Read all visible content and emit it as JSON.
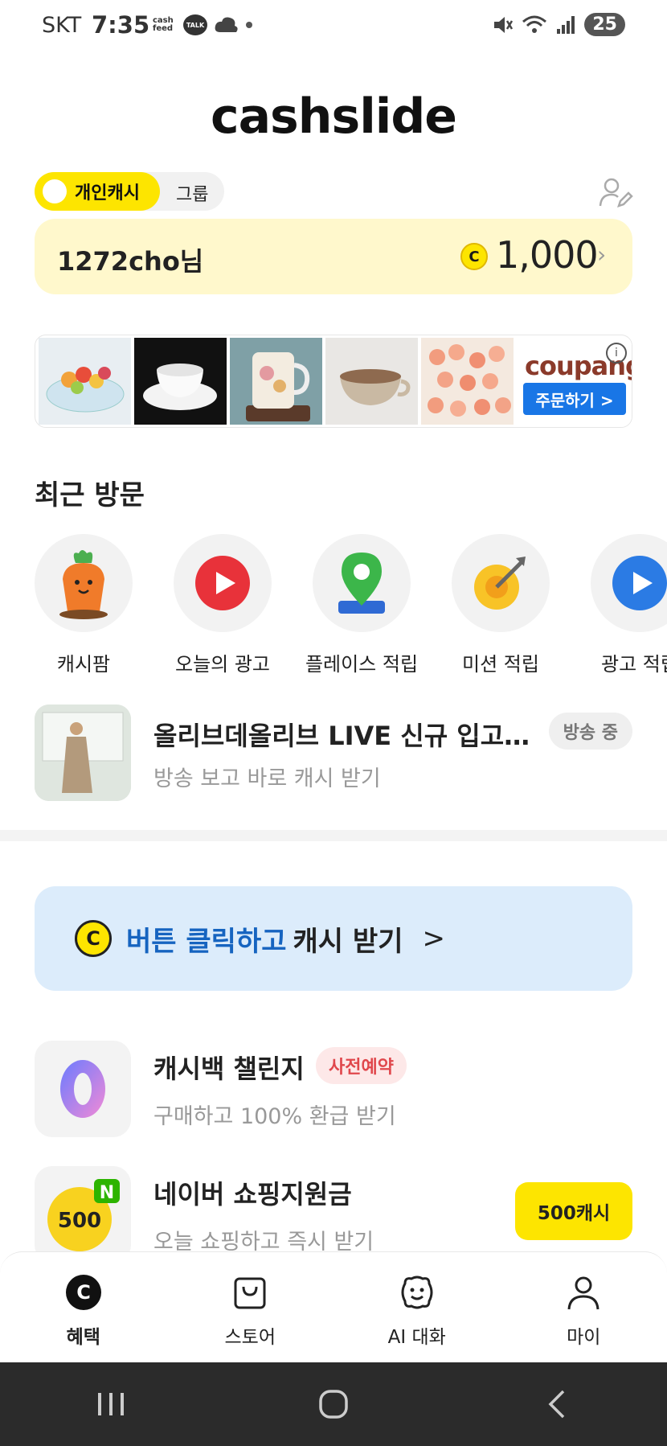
{
  "status_bar": {
    "carrier": "SKT",
    "time": "7:35",
    "cashfeed_label": "cash feed",
    "talk_label": "TALK",
    "battery": "25",
    "icons": [
      "mute-icon",
      "wifi-icon",
      "signal-icon"
    ]
  },
  "app": {
    "logo": "cashslide"
  },
  "toggle": {
    "personal": "개인캐시",
    "group": "그룹"
  },
  "cash_card": {
    "username": "1272cho님",
    "coin_symbol": "C",
    "amount": "1,000"
  },
  "ad_banner": {
    "brand": "coupang",
    "cta": "주문하기 >",
    "info_symbol": "i",
    "thumbs": [
      "fruit-tray",
      "white-cup",
      "flower-mug",
      "ceramic-bowl",
      "shrimp"
    ]
  },
  "recent": {
    "title": "최근 방문",
    "items": [
      {
        "label": "캐시팜",
        "icon": "carrot-icon"
      },
      {
        "label": "오늘의 광고",
        "icon": "play-red-icon"
      },
      {
        "label": "플레이스 적립",
        "icon": "map-pin-icon"
      },
      {
        "label": "미션 적립",
        "icon": "target-icon"
      },
      {
        "label": "광고 적립",
        "icon": "play-blue-icon"
      }
    ]
  },
  "live": {
    "title": "올리브데올리브 LIVE 신규 입고…",
    "subtitle": "방송 보고 바로 캐시 받기",
    "badge": "방송 중"
  },
  "cash_button_banner": {
    "coin_symbol": "C",
    "highlight": "버튼 클릭하고",
    "text": "캐시 받기",
    "arrow": ">"
  },
  "list": [
    {
      "title": "캐시백 챌린지",
      "subtitle": "구매하고 100% 환급 받기",
      "tag": "사전예약",
      "icon": "zero-icon",
      "icon_text": "0"
    },
    {
      "title": "네이버 쇼핑지원금",
      "subtitle": "오늘 쇼핑하고 즉시 받기",
      "action": "500캐시",
      "icon": "naver-500-icon",
      "icon_text": "500",
      "icon_badge": "N"
    }
  ],
  "bottom_nav": [
    {
      "label": "혜택",
      "icon": "coin-c-icon",
      "active": true
    },
    {
      "label": "스토어",
      "icon": "shopping-bag-icon"
    },
    {
      "label": "AI 대화",
      "icon": "smile-face-icon"
    },
    {
      "label": "마이",
      "icon": "person-icon"
    }
  ],
  "colors": {
    "accent_yellow": "#fde500",
    "card_bg": "#fff8cc",
    "banner_blue": "#dcecfb",
    "link_blue": "#1664c0",
    "tag_red": "#e0474c"
  }
}
